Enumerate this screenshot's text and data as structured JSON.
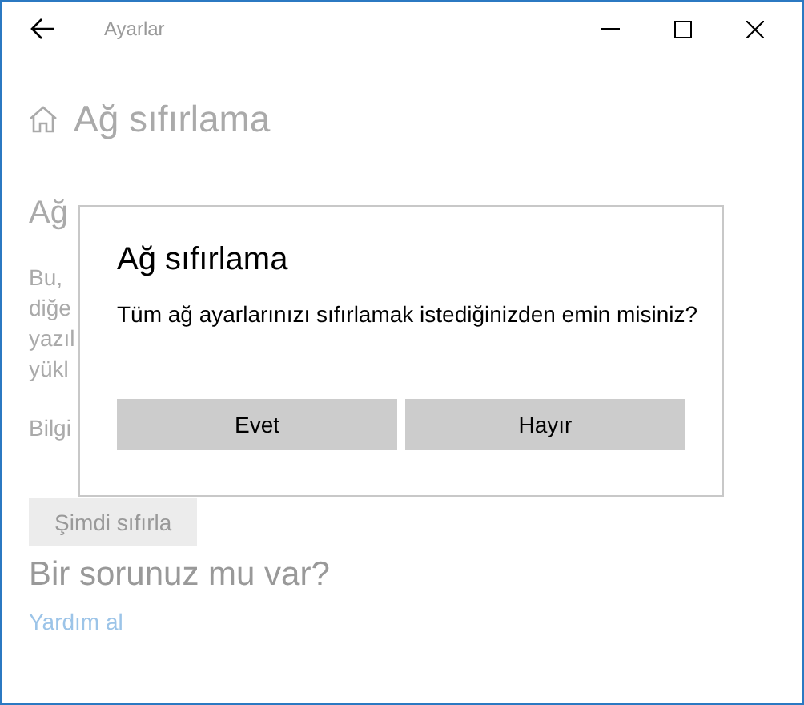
{
  "window": {
    "title": "Ayarlar"
  },
  "page": {
    "title": "Ağ sıfırlama",
    "section_title": "Ağ",
    "paragraph_lines": [
      "Bu,",
      "diğe",
      "yazıl",
      "yükl"
    ],
    "note": "Bilgi",
    "reset_button": "Şimdi sıfırla",
    "help_title": "Bir sorunuz mu var?",
    "help_link": "Yardım al"
  },
  "dialog": {
    "title": "Ağ sıfırlama",
    "message": "Tüm ağ ayarlarınızı sıfırlamak istediğinizden emin misiniz?",
    "buttons": [
      "Evet",
      "Hayır"
    ]
  }
}
